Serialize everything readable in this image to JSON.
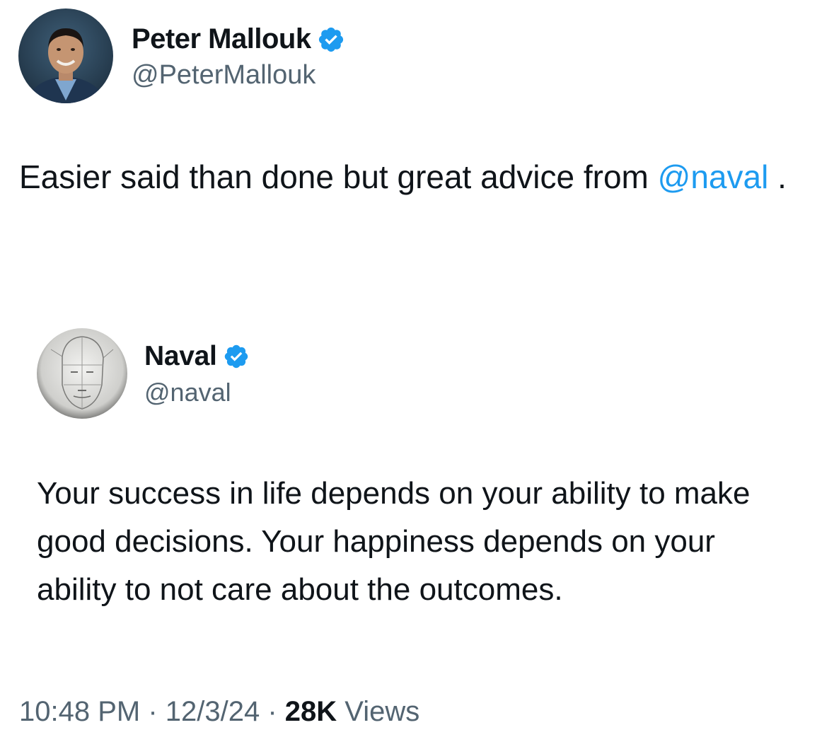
{
  "tweet": {
    "author": {
      "name": "Peter Mallouk",
      "handle": "@PeterMallouk",
      "verified": true
    },
    "text_before": "Easier said than done but great advice from ",
    "mention": "@naval",
    "text_after": " ."
  },
  "quoted_tweet": {
    "author": {
      "name": "Naval",
      "handle": "@naval",
      "verified": true
    },
    "text": "Your success in life depends on your ability to make good decisions. Your happiness depends on your ability to not care about the outcomes."
  },
  "meta": {
    "time": "10:48 PM",
    "separator": " · ",
    "date": "12/3/24",
    "views_count": "28K",
    "views_label": " Views"
  },
  "colors": {
    "text": "#0f1419",
    "secondary": "#536471",
    "accent": "#1d9bf0"
  },
  "icons": {
    "verified": "verified-badge-icon",
    "avatar_main": "profile-photo",
    "avatar_quoted": "sketch-profile-photo"
  }
}
